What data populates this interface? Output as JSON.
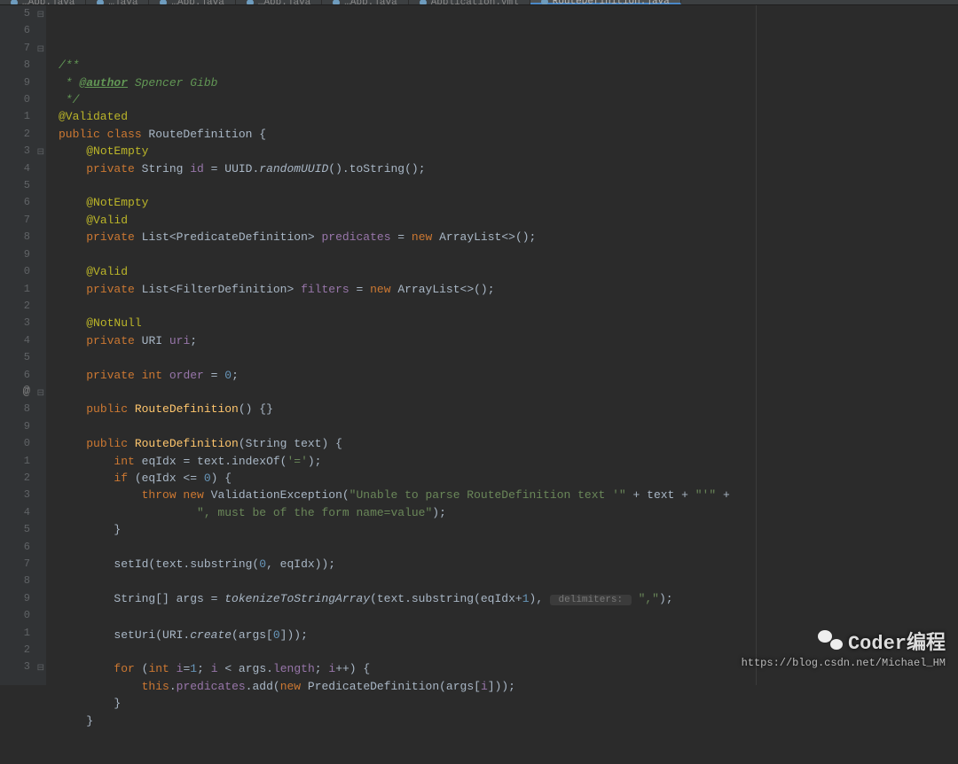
{
  "tabs": [
    {
      "label": "…App.java",
      "active": false
    },
    {
      "label": "…java",
      "active": false
    },
    {
      "label": "…App.java",
      "active": false
    },
    {
      "label": "…App.java",
      "active": false
    },
    {
      "label": "…App.java",
      "active": false
    },
    {
      "label": "Application.yml",
      "active": false
    },
    {
      "label": "RouteDefinition.java",
      "active": true
    }
  ],
  "line_numbers": [
    "5",
    "6",
    "7",
    "8",
    "9",
    "0",
    "1",
    "2",
    "3",
    "4",
    "5",
    "6",
    "7",
    "8",
    "9",
    "0",
    "1",
    "2",
    "3",
    "4",
    "5",
    "6",
    "7",
    "8",
    "9",
    "0",
    "1",
    "2",
    "3",
    "4",
    "5",
    "6",
    "7",
    "8",
    "9",
    "0",
    "1",
    "2",
    "3"
  ],
  "fold_marks": [
    {
      "line": 0,
      "sym": "⊟"
    },
    {
      "line": 2,
      "sym": "⊟"
    },
    {
      "line": 8,
      "sym": "⊟"
    },
    {
      "line": 22,
      "sym": "⊟"
    },
    {
      "line": 38,
      "sym": "⊟"
    }
  ],
  "at_symbol_line": 22,
  "code_tokens": [
    [
      {
        "t": "/**",
        "c": "c-doc"
      }
    ],
    [
      {
        "t": " * ",
        "c": "c-doc"
      },
      {
        "t": "@author",
        "c": "c-doctag"
      },
      {
        "t": " Spencer Gibb",
        "c": "c-doc"
      }
    ],
    [
      {
        "t": " */",
        "c": "c-doc"
      }
    ],
    [
      {
        "t": "@Validated",
        "c": "c-ann"
      }
    ],
    [
      {
        "t": "public class ",
        "c": "c-kw"
      },
      {
        "t": "RouteDefinition {",
        "c": "c-cls"
      }
    ],
    [
      {
        "t": "    ",
        "c": ""
      },
      {
        "t": "@NotEmpty",
        "c": "c-ann"
      }
    ],
    [
      {
        "t": "    ",
        "c": ""
      },
      {
        "t": "private ",
        "c": "c-kw"
      },
      {
        "t": "String ",
        "c": ""
      },
      {
        "t": "id",
        "c": "c-field"
      },
      {
        "t": " = UUID.",
        "c": ""
      },
      {
        "t": "randomUUID",
        "c": "c-static"
      },
      {
        "t": "().toString();",
        "c": ""
      }
    ],
    [
      {
        "t": "",
        "c": ""
      }
    ],
    [
      {
        "t": "    ",
        "c": ""
      },
      {
        "t": "@NotEmpty",
        "c": "c-ann"
      }
    ],
    [
      {
        "t": "    ",
        "c": ""
      },
      {
        "t": "@Valid",
        "c": "c-ann"
      }
    ],
    [
      {
        "t": "    ",
        "c": ""
      },
      {
        "t": "private ",
        "c": "c-kw"
      },
      {
        "t": "List<PredicateDefinition> ",
        "c": ""
      },
      {
        "t": "predicates",
        "c": "c-field"
      },
      {
        "t": " = ",
        "c": ""
      },
      {
        "t": "new ",
        "c": "c-kw"
      },
      {
        "t": "ArrayList<>();",
        "c": ""
      }
    ],
    [
      {
        "t": "",
        "c": ""
      }
    ],
    [
      {
        "t": "    ",
        "c": ""
      },
      {
        "t": "@Valid",
        "c": "c-ann"
      }
    ],
    [
      {
        "t": "    ",
        "c": ""
      },
      {
        "t": "private ",
        "c": "c-kw"
      },
      {
        "t": "List<FilterDefinition> ",
        "c": ""
      },
      {
        "t": "filters",
        "c": "c-field"
      },
      {
        "t": " = ",
        "c": ""
      },
      {
        "t": "new ",
        "c": "c-kw"
      },
      {
        "t": "ArrayList<>();",
        "c": ""
      }
    ],
    [
      {
        "t": "",
        "c": ""
      }
    ],
    [
      {
        "t": "    ",
        "c": ""
      },
      {
        "t": "@NotNull",
        "c": "c-ann"
      }
    ],
    [
      {
        "t": "    ",
        "c": ""
      },
      {
        "t": "private ",
        "c": "c-kw"
      },
      {
        "t": "URI ",
        "c": ""
      },
      {
        "t": "uri",
        "c": "c-field"
      },
      {
        "t": ";",
        "c": ""
      }
    ],
    [
      {
        "t": "",
        "c": ""
      }
    ],
    [
      {
        "t": "    ",
        "c": ""
      },
      {
        "t": "private int ",
        "c": "c-kw"
      },
      {
        "t": "order",
        "c": "c-field"
      },
      {
        "t": " = ",
        "c": ""
      },
      {
        "t": "0",
        "c": "c-num"
      },
      {
        "t": ";",
        "c": ""
      }
    ],
    [
      {
        "t": "",
        "c": ""
      }
    ],
    [
      {
        "t": "    ",
        "c": ""
      },
      {
        "t": "public ",
        "c": "c-kw"
      },
      {
        "t": "RouteDefinition",
        "c": "c-method"
      },
      {
        "t": "() {}",
        "c": ""
      }
    ],
    [
      {
        "t": "",
        "c": ""
      }
    ],
    [
      {
        "t": "    ",
        "c": ""
      },
      {
        "t": "public ",
        "c": "c-kw"
      },
      {
        "t": "RouteDefinition",
        "c": "c-method"
      },
      {
        "t": "(String text) {",
        "c": ""
      }
    ],
    [
      {
        "t": "        ",
        "c": ""
      },
      {
        "t": "int ",
        "c": "c-kw"
      },
      {
        "t": "eqIdx = text.indexOf(",
        "c": ""
      },
      {
        "t": "'='",
        "c": "c-str"
      },
      {
        "t": ");",
        "c": ""
      }
    ],
    [
      {
        "t": "        ",
        "c": ""
      },
      {
        "t": "if ",
        "c": "c-kw"
      },
      {
        "t": "(eqIdx <= ",
        "c": ""
      },
      {
        "t": "0",
        "c": "c-num"
      },
      {
        "t": ") {",
        "c": ""
      }
    ],
    [
      {
        "t": "            ",
        "c": ""
      },
      {
        "t": "throw new ",
        "c": "c-kw"
      },
      {
        "t": "ValidationException(",
        "c": ""
      },
      {
        "t": "\"Unable to parse RouteDefinition text '\"",
        "c": "c-str"
      },
      {
        "t": " + text + ",
        "c": ""
      },
      {
        "t": "\"'\"",
        "c": "c-str"
      },
      {
        "t": " +",
        "c": ""
      }
    ],
    [
      {
        "t": "                    ",
        "c": ""
      },
      {
        "t": "\", must be of the form name=value\"",
        "c": "c-str"
      },
      {
        "t": ");",
        "c": ""
      }
    ],
    [
      {
        "t": "        }",
        "c": ""
      }
    ],
    [
      {
        "t": "",
        "c": ""
      }
    ],
    [
      {
        "t": "        setId(text.substring(",
        "c": ""
      },
      {
        "t": "0",
        "c": "c-num"
      },
      {
        "t": ", eqIdx));",
        "c": ""
      }
    ],
    [
      {
        "t": "",
        "c": ""
      }
    ],
    [
      {
        "t": "        String[] args = ",
        "c": ""
      },
      {
        "t": "tokenizeToStringArray",
        "c": "c-static"
      },
      {
        "t": "(text.substring(eqIdx+",
        "c": ""
      },
      {
        "t": "1",
        "c": "c-num"
      },
      {
        "t": "), ",
        "c": ""
      },
      {
        "t": " delimiters: ",
        "c": "c-hint"
      },
      {
        "t": " ",
        "c": ""
      },
      {
        "t": "\",\"",
        "c": "c-str"
      },
      {
        "t": ");",
        "c": ""
      }
    ],
    [
      {
        "t": "",
        "c": ""
      }
    ],
    [
      {
        "t": "        setUri(URI.",
        "c": ""
      },
      {
        "t": "create",
        "c": "c-static"
      },
      {
        "t": "(args[",
        "c": ""
      },
      {
        "t": "0",
        "c": "c-num"
      },
      {
        "t": "]));",
        "c": ""
      }
    ],
    [
      {
        "t": "",
        "c": ""
      }
    ],
    [
      {
        "t": "        ",
        "c": ""
      },
      {
        "t": "for ",
        "c": "c-kw"
      },
      {
        "t": "(",
        "c": ""
      },
      {
        "t": "int ",
        "c": "c-kw"
      },
      {
        "t": "i",
        "c": "c-field"
      },
      {
        "t": "=",
        "c": ""
      },
      {
        "t": "1",
        "c": "c-num"
      },
      {
        "t": "; ",
        "c": ""
      },
      {
        "t": "i",
        "c": "c-field"
      },
      {
        "t": " < args.",
        "c": ""
      },
      {
        "t": "length",
        "c": "c-field"
      },
      {
        "t": "; ",
        "c": ""
      },
      {
        "t": "i",
        "c": "c-field"
      },
      {
        "t": "++) {",
        "c": ""
      }
    ],
    [
      {
        "t": "            ",
        "c": ""
      },
      {
        "t": "this",
        "c": "c-kw"
      },
      {
        "t": ".",
        "c": ""
      },
      {
        "t": "predicates",
        "c": "c-field"
      },
      {
        "t": ".add(",
        "c": ""
      },
      {
        "t": "new ",
        "c": "c-kw"
      },
      {
        "t": "PredicateDefinition(args[",
        "c": ""
      },
      {
        "t": "i",
        "c": "c-field"
      },
      {
        "t": "]));",
        "c": ""
      }
    ],
    [
      {
        "t": "        }",
        "c": ""
      }
    ],
    [
      {
        "t": "    }",
        "c": ""
      }
    ]
  ],
  "watermark": {
    "brand": "Coder编程",
    "url": "https://blog.csdn.net/Michael_HM"
  }
}
